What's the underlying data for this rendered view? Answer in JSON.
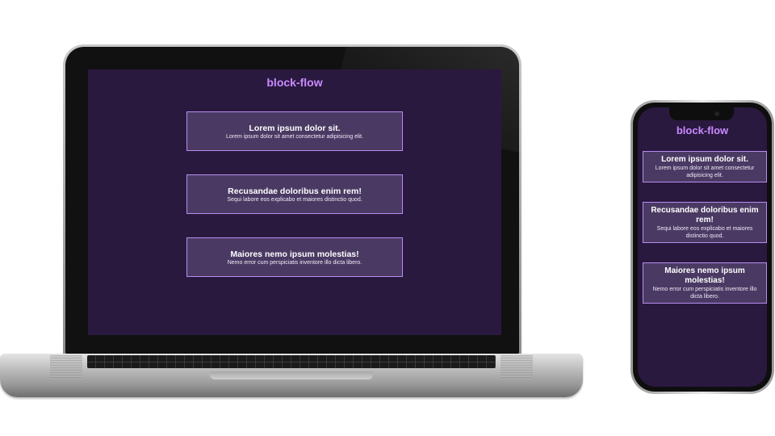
{
  "app": {
    "title": "block-flow",
    "accent_color": "#c98bff",
    "background_color": "#2a193f",
    "card_background": "#4a3a63",
    "card_border": "#b78cf0"
  },
  "cards": [
    {
      "title": "Lorem ipsum dolor sit.",
      "text": "Lorem ipsum dolor sit amet consectetur adipisicing elit."
    },
    {
      "title": "Recusandae doloribus enim rem!",
      "text": "Sequi labore eos explicabo et maiores distinctio quod."
    },
    {
      "title": "Maiores nemo ipsum molestias!",
      "text": "Nemo error cum perspiciatis inventore illo dicta libero."
    }
  ]
}
